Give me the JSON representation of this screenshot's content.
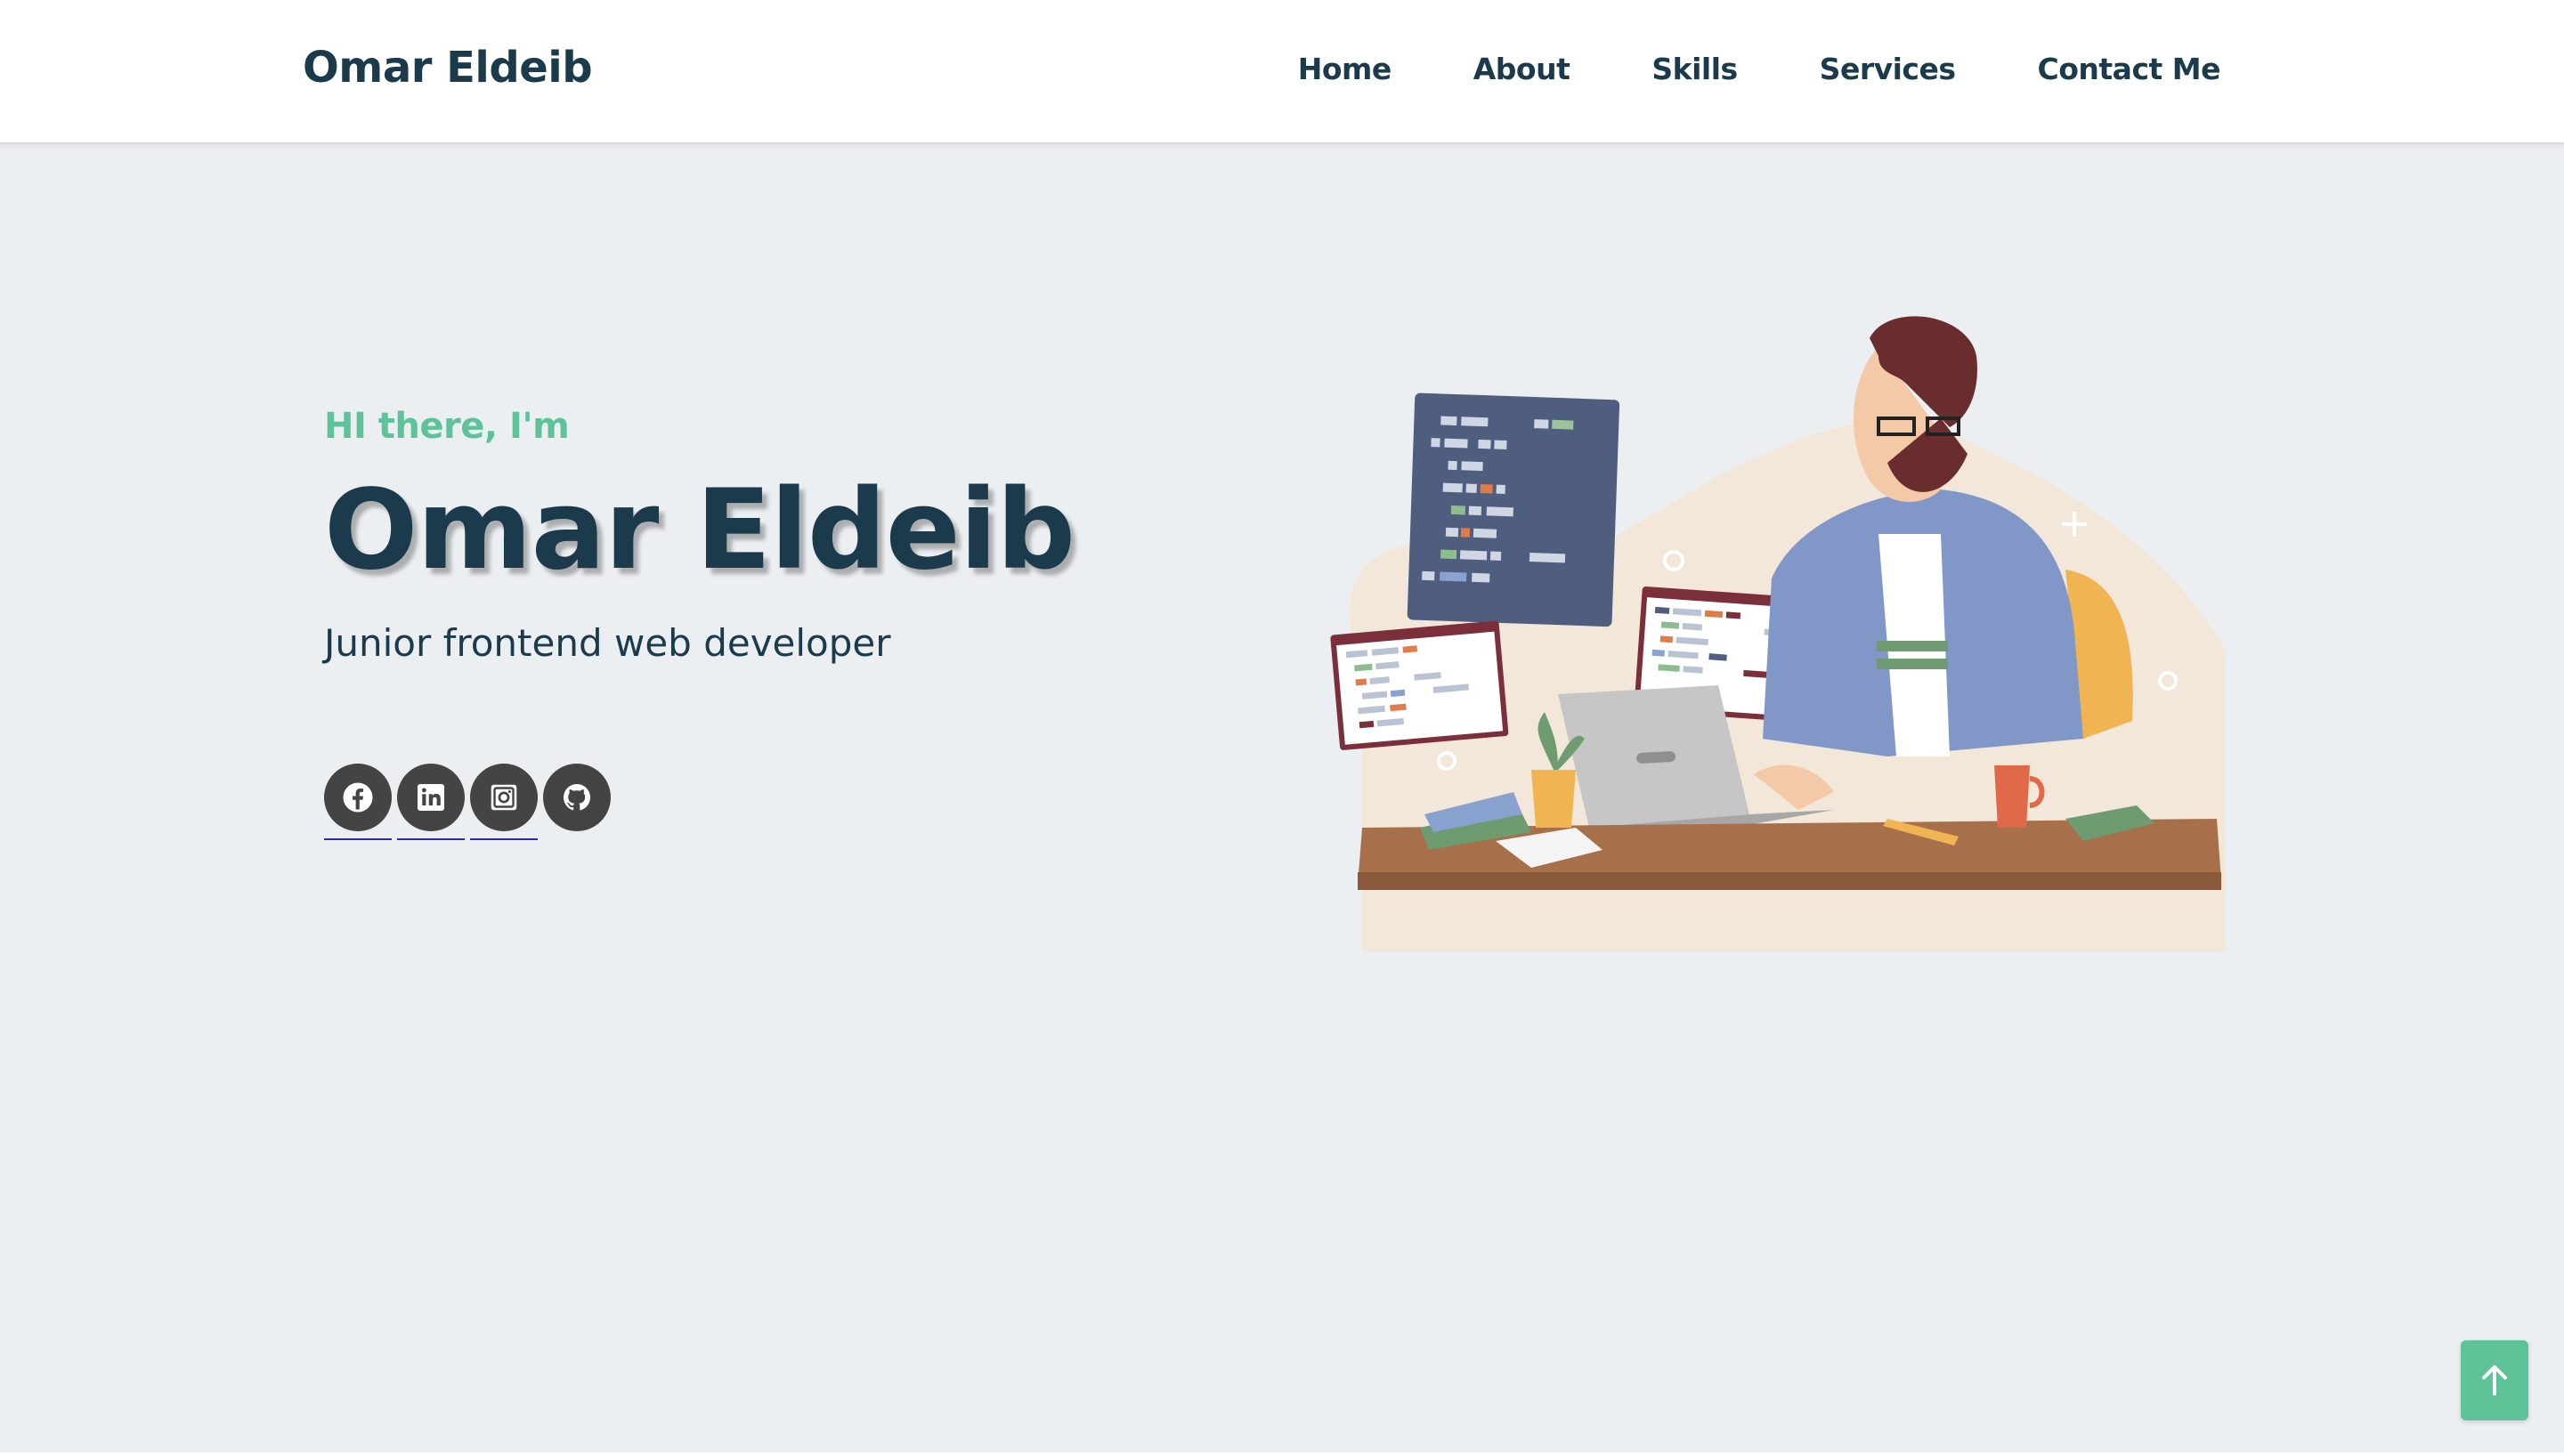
{
  "header": {
    "brand": "Omar Eldeib",
    "nav": [
      {
        "label": "Home"
      },
      {
        "label": "About"
      },
      {
        "label": "Skills"
      },
      {
        "label": "Services"
      },
      {
        "label": "Contact Me"
      }
    ]
  },
  "hero": {
    "greeting": "HI there, I'm",
    "name": "Omar Eldeib",
    "role": "Junior frontend web developer",
    "socials": [
      {
        "icon": "facebook-icon"
      },
      {
        "icon": "linkedin-icon"
      },
      {
        "icon": "instagram-icon"
      },
      {
        "icon": "github-icon"
      }
    ]
  },
  "colors": {
    "accent": "#5ec398",
    "heading": "#1b3a4b",
    "background": "#eceff2",
    "social_bg": "#444444"
  },
  "back_to_top": {
    "icon": "arrow-up-icon"
  }
}
